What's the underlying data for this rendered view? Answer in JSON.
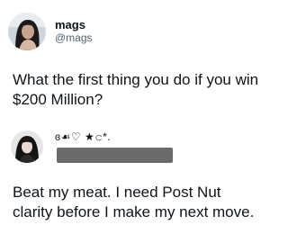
{
  "post": {
    "display_name": "mags",
    "handle": "@mags",
    "text": "What the first thing you do if you win $200 Million?"
  },
  "reply": {
    "decoration": "ɞ☙♡ ★𝚌*.",
    "name_redacted": true,
    "text": "Beat my meat. I need Post Nut clarity before I make my next move."
  },
  "icons": {
    "post_avatar": "profile-photo-icon",
    "reply_avatar": "profile-photo-icon"
  },
  "colors": {
    "text": "#0f1419",
    "secondary_text": "#536471",
    "redaction_bar": "#6b6b6b"
  }
}
